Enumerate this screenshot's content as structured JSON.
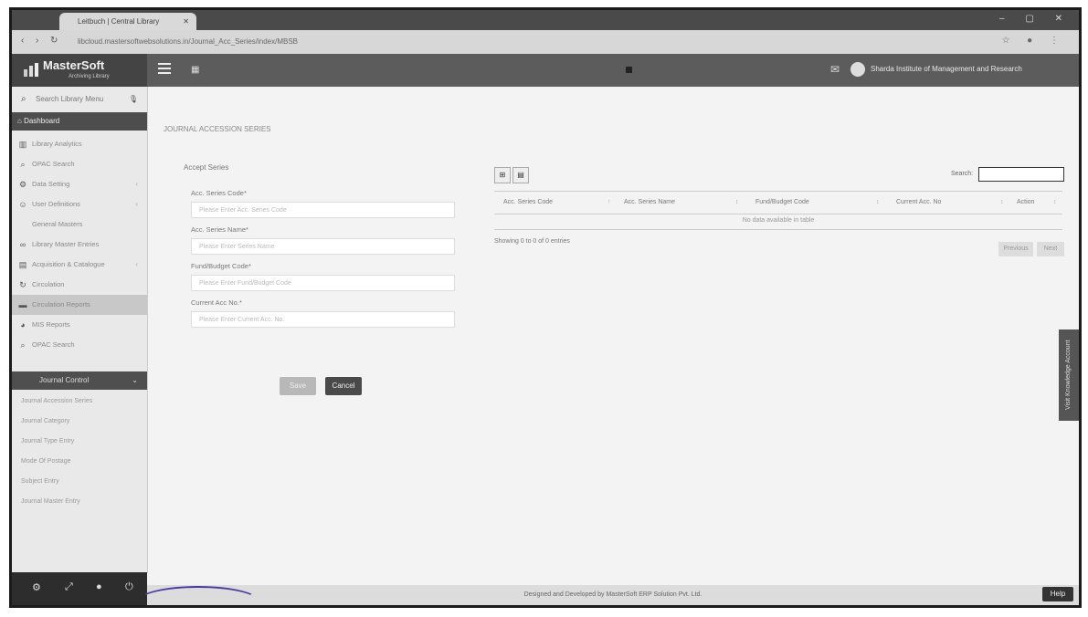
{
  "browser": {
    "tab_title": "Leitbuch | Central Library",
    "url": "libcloud.mastersoftwebsolutions.in/Journal_Acc_Series/index/MBSB",
    "window_controls": "– ▢ ✕"
  },
  "app": {
    "brand": "MasterSoft",
    "brand_sub": "Archiving Library",
    "institution": "Sharda Institute of Management and Research"
  },
  "sidebar": {
    "search_placeholder": "Search Library Menu",
    "dashboard_label": "Dashboard",
    "items": [
      {
        "label": "Library Analytics",
        "icon": "chart-icon"
      },
      {
        "label": "OPAC Search",
        "icon": "search-icon"
      },
      {
        "label": "Data Setting",
        "icon": "gear-icon"
      },
      {
        "label": "User Definitions",
        "icon": "users-icon"
      },
      {
        "label": "General Masters",
        "icon": "none"
      },
      {
        "label": "Library Master Entries",
        "icon": "link-icon"
      },
      {
        "label": "Acquisition & Catalogue",
        "icon": "book-icon"
      },
      {
        "label": "Circulation",
        "icon": "refresh-icon"
      },
      {
        "label": "Circulation Reports",
        "icon": "report-icon"
      },
      {
        "label": "MIS Reports",
        "icon": "pie-icon"
      },
      {
        "label": "OPAC Search",
        "icon": "search-icon"
      }
    ],
    "journal_control_label": "Journal Control",
    "sub_items": [
      "Journal Accession Series",
      "Journal Category",
      "Journal Type Entry",
      "Mode Of Postage",
      "Subject Entry",
      "Journal Master Entry"
    ]
  },
  "breadcrumb": "JOURNAL ACCESSION SERIES",
  "form": {
    "panel_title": "Accept Series",
    "fields": [
      {
        "label": "Acc. Series Code*",
        "placeholder": "Please Enter Acc. Series Code"
      },
      {
        "label": "Acc. Series Name*",
        "placeholder": "Please Enter Series Name"
      },
      {
        "label": "Fund/Budget Code*",
        "placeholder": "Please Enter Fund/Budget Code"
      },
      {
        "label": "Current Acc No.*",
        "placeholder": "Please Enter Current Acc. No."
      }
    ],
    "save_label": "Save",
    "cancel_label": "Cancel"
  },
  "table": {
    "search_label": "Search:",
    "columns": [
      "Acc. Series Code",
      "Acc. Series Name",
      "Fund/Budget Code",
      "Current Acc. No",
      "Action"
    ],
    "empty_message": "No data available in table",
    "showing": "Showing 0 to 0 of 0 entries",
    "prev_label": "Previous",
    "next_label": "Next"
  },
  "side_tab_label": "Visit Knowledge Account",
  "footer": "Designed and Developed by MasterSoft ERP Solution Pvt. Ltd.",
  "help_label": "Help"
}
